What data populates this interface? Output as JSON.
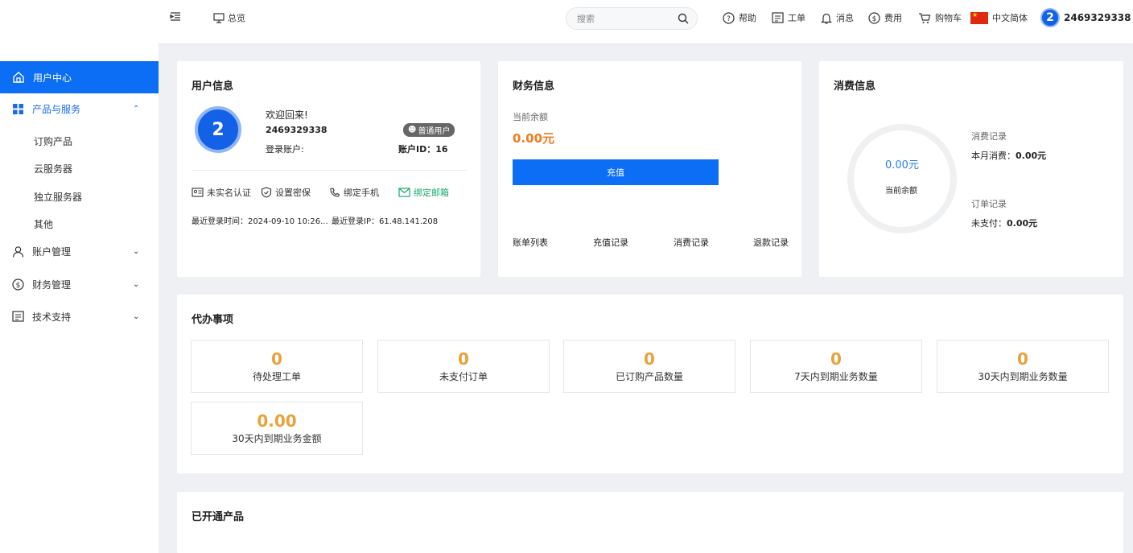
{
  "header": {
    "overview": "总览",
    "search_placeholder": "搜索",
    "help": "帮助",
    "ticket": "工单",
    "message": "消息",
    "fee": "费用",
    "cart": "购物车",
    "language": "中文简体",
    "avatar_initial": "2",
    "username": "2469329338"
  },
  "sidebar": {
    "user_center": "用户中心",
    "products": "产品与服务",
    "sub": [
      "订购产品",
      "云服务器",
      "独立服务器",
      "其他"
    ],
    "account": "账户管理",
    "finance": "财务管理",
    "support": "技术支持"
  },
  "user_info": {
    "title": "用户信息",
    "avatar_initial": "2",
    "welcome": "欢迎回来!",
    "username": "2469329338",
    "badge": "普通用户",
    "login_account_label": "登录账户:",
    "account_id": "账户ID：16",
    "real_name": "未实名认证",
    "security": "设置密保",
    "bind_phone": "绑定手机",
    "bind_email": "绑定邮箱",
    "last_login_time": "最近登录时间：2024-09-10 10:26...",
    "last_login_ip": "最近登录IP：61.48.141.208"
  },
  "finance": {
    "title": "财务信息",
    "balance_label": "当前余额",
    "balance": "0.00元",
    "recharge": "充值",
    "links": [
      "账单列表",
      "充值记录",
      "消费记录",
      "退款记录"
    ]
  },
  "consume": {
    "title": "消费信息",
    "ring_value": "0.00元",
    "ring_label": "当前余额",
    "record_title": "消费记录",
    "month_label": "本月消费：",
    "month_value": "0.00元",
    "order_title": "订单记录",
    "unpaid_label": "未支付：",
    "unpaid_value": "0.00元"
  },
  "todo": {
    "title": "代办事项",
    "items": [
      {
        "num": "0",
        "label": "待处理工单"
      },
      {
        "num": "0",
        "label": "未支付订单"
      },
      {
        "num": "0",
        "label": "已订购产品数量"
      },
      {
        "num": "0",
        "label": "7天内到期业务数量"
      },
      {
        "num": "0",
        "label": "30天内到期业务数量"
      },
      {
        "num": "0.00",
        "label": "30天内到期业务金额"
      }
    ]
  },
  "opened": {
    "title": "已开通产品"
  }
}
